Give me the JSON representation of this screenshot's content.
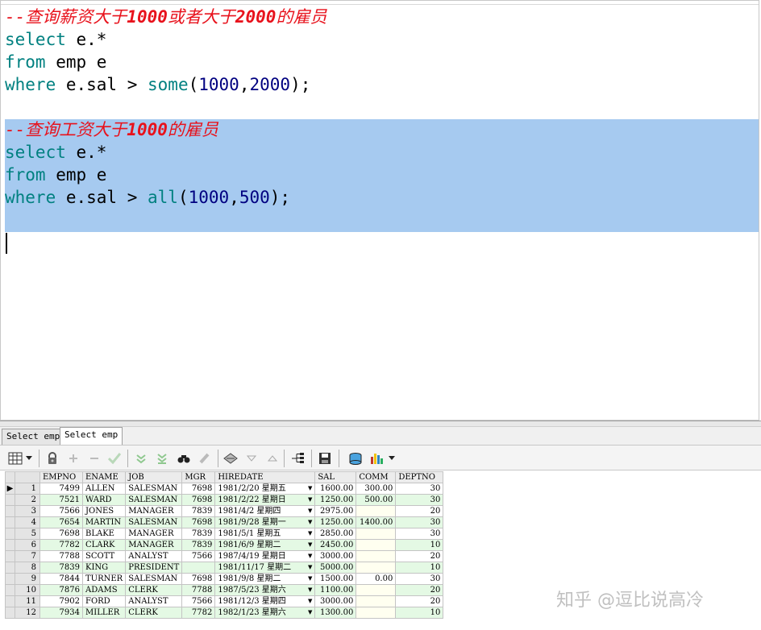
{
  "editor": {
    "query1": {
      "comment_prefix": "--",
      "comment_a": "查询薪资大于",
      "comment_num1": "1000",
      "comment_b": "或者大于",
      "comment_num2": "2000",
      "comment_c": "的雇员",
      "l2_kw": "select",
      "l2_rest": " e.*",
      "l3_kw": "from",
      "l3_rest": " emp e",
      "l4_kw": "where",
      "l4_mid": " e.sal > ",
      "l4_fn": "some",
      "l4_open": "(",
      "l4_v1": "1000",
      "l4_comma": ",",
      "l4_v2": "2000",
      "l4_close": ");"
    },
    "query2": {
      "comment_prefix": "--",
      "comment_a": "查询工资大于",
      "comment_num1": "1000",
      "comment_c": "的雇员",
      "l2_kw": "select",
      "l2_rest": " e.*",
      "l3_kw": "from",
      "l3_rest": " emp e",
      "l4_kw": "where",
      "l4_mid": " e.sal > ",
      "l4_fn": "all",
      "l4_open": "(",
      "l4_v1": "1000",
      "l4_comma": ",",
      "l4_v2": "500",
      "l4_close": ");"
    },
    "selection_color": "#a6caf0",
    "comment_color": "#e8121c",
    "keyword_color": "#008080",
    "number_color": "#000080"
  },
  "tabs": [
    {
      "label": "Select emp",
      "active": false
    },
    {
      "label": "Select emp",
      "active": true
    }
  ],
  "toolbar": {
    "icons": [
      "grid-view-icon",
      "dropdown-arrow-icon",
      "lock-icon",
      "add-record-icon",
      "delete-record-icon",
      "post-check-icon",
      "next-page-icon",
      "last-page-icon",
      "find-icon",
      "clear-icon",
      "filter-icon",
      "sort-down-icon",
      "sort-up-icon",
      "query-tree-icon",
      "save-icon",
      "export-icon",
      "chart-icon",
      "dropdown-arrow-icon"
    ]
  },
  "grid": {
    "columns": [
      "EMPNO",
      "ENAME",
      "JOB",
      "MGR",
      "HIREDATE",
      "SAL",
      "COMM",
      "DEPTNO"
    ],
    "rows": [
      {
        "n": "1",
        "empno": "7499",
        "ename": "ALLEN",
        "job": "SALESMAN",
        "mgr": "7698",
        "hiredate": "1981/2/20 星期五",
        "sal": "1600.00",
        "comm": "300.00",
        "deptno": "30"
      },
      {
        "n": "2",
        "empno": "7521",
        "ename": "WARD",
        "job": "SALESMAN",
        "mgr": "7698",
        "hiredate": "1981/2/22 星期日",
        "sal": "1250.00",
        "comm": "500.00",
        "deptno": "30"
      },
      {
        "n": "3",
        "empno": "7566",
        "ename": "JONES",
        "job": "MANAGER",
        "mgr": "7839",
        "hiredate": "1981/4/2 星期四",
        "sal": "2975.00",
        "comm": "",
        "deptno": "20"
      },
      {
        "n": "4",
        "empno": "7654",
        "ename": "MARTIN",
        "job": "SALESMAN",
        "mgr": "7698",
        "hiredate": "1981/9/28 星期一",
        "sal": "1250.00",
        "comm": "1400.00",
        "deptno": "30"
      },
      {
        "n": "5",
        "empno": "7698",
        "ename": "BLAKE",
        "job": "MANAGER",
        "mgr": "7839",
        "hiredate": "1981/5/1 星期五",
        "sal": "2850.00",
        "comm": "",
        "deptno": "30"
      },
      {
        "n": "6",
        "empno": "7782",
        "ename": "CLARK",
        "job": "MANAGER",
        "mgr": "7839",
        "hiredate": "1981/6/9 星期二",
        "sal": "2450.00",
        "comm": "",
        "deptno": "10"
      },
      {
        "n": "7",
        "empno": "7788",
        "ename": "SCOTT",
        "job": "ANALYST",
        "mgr": "7566",
        "hiredate": "1987/4/19 星期日",
        "sal": "3000.00",
        "comm": "",
        "deptno": "20"
      },
      {
        "n": "8",
        "empno": "7839",
        "ename": "KING",
        "job": "PRESIDENT",
        "mgr": "",
        "hiredate": "1981/11/17 星期二",
        "sal": "5000.00",
        "comm": "",
        "deptno": "10"
      },
      {
        "n": "9",
        "empno": "7844",
        "ename": "TURNER",
        "job": "SALESMAN",
        "mgr": "7698",
        "hiredate": "1981/9/8 星期二",
        "sal": "1500.00",
        "comm": "0.00",
        "deptno": "30"
      },
      {
        "n": "10",
        "empno": "7876",
        "ename": "ADAMS",
        "job": "CLERK",
        "mgr": "7788",
        "hiredate": "1987/5/23 星期六",
        "sal": "1100.00",
        "comm": "",
        "deptno": "20"
      },
      {
        "n": "11",
        "empno": "7902",
        "ename": "FORD",
        "job": "ANALYST",
        "mgr": "7566",
        "hiredate": "1981/12/3 星期四",
        "sal": "3000.00",
        "comm": "",
        "deptno": "20"
      },
      {
        "n": "12",
        "empno": "7934",
        "ename": "MILLER",
        "job": "CLERK",
        "mgr": "7782",
        "hiredate": "1982/1/23 星期六",
        "sal": "1300.00",
        "comm": "",
        "deptno": "10"
      }
    ],
    "current_row_marker": "▶"
  },
  "watermark": "知乎 @逗比说高冷"
}
